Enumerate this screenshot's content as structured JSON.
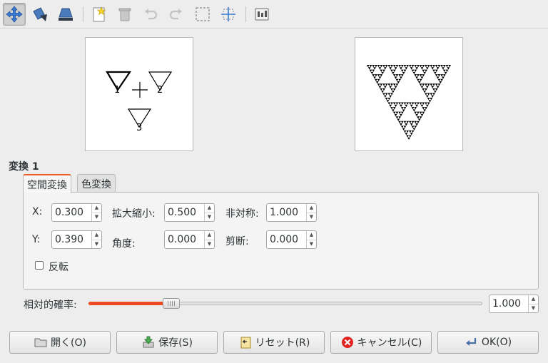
{
  "toolbar": {
    "icons": [
      "move-icon",
      "rotate-scale-icon",
      "stretch-icon",
      "new-transform-icon",
      "delete-icon",
      "undo-icon",
      "redo-icon",
      "select-all-icon",
      "recompute-center-icon",
      "render-options-icon"
    ]
  },
  "preview": {
    "triangles": [
      "1",
      "2",
      "3"
    ]
  },
  "section": {
    "title": "変換 1"
  },
  "tabs": [
    {
      "label": "空間変換",
      "selected": true
    },
    {
      "label": "色変換",
      "selected": false
    }
  ],
  "fields": {
    "x": {
      "label": "X:",
      "value": "0.300"
    },
    "y": {
      "label": "Y:",
      "value": "0.390"
    },
    "scale": {
      "label": "拡大縮小:",
      "value": "0.500"
    },
    "angle": {
      "label": "角度:",
      "value": "0.000"
    },
    "asymmetry": {
      "label": "非対称:",
      "value": "1.000"
    },
    "shear": {
      "label": "剪断:",
      "value": "0.000"
    }
  },
  "flip": {
    "label": "反転",
    "checked": false
  },
  "probability": {
    "label": "相対的確率:",
    "value": "1.000",
    "fraction": 0.21
  },
  "buttons": {
    "open": "開く(O)",
    "save": "保存(S)",
    "reset": "リセット(R)",
    "cancel": "キャンセル(C)",
    "ok": "OK(O)"
  },
  "colors": {
    "accent": "#ef4b23",
    "tab_highlight": "#ef5a2a"
  }
}
